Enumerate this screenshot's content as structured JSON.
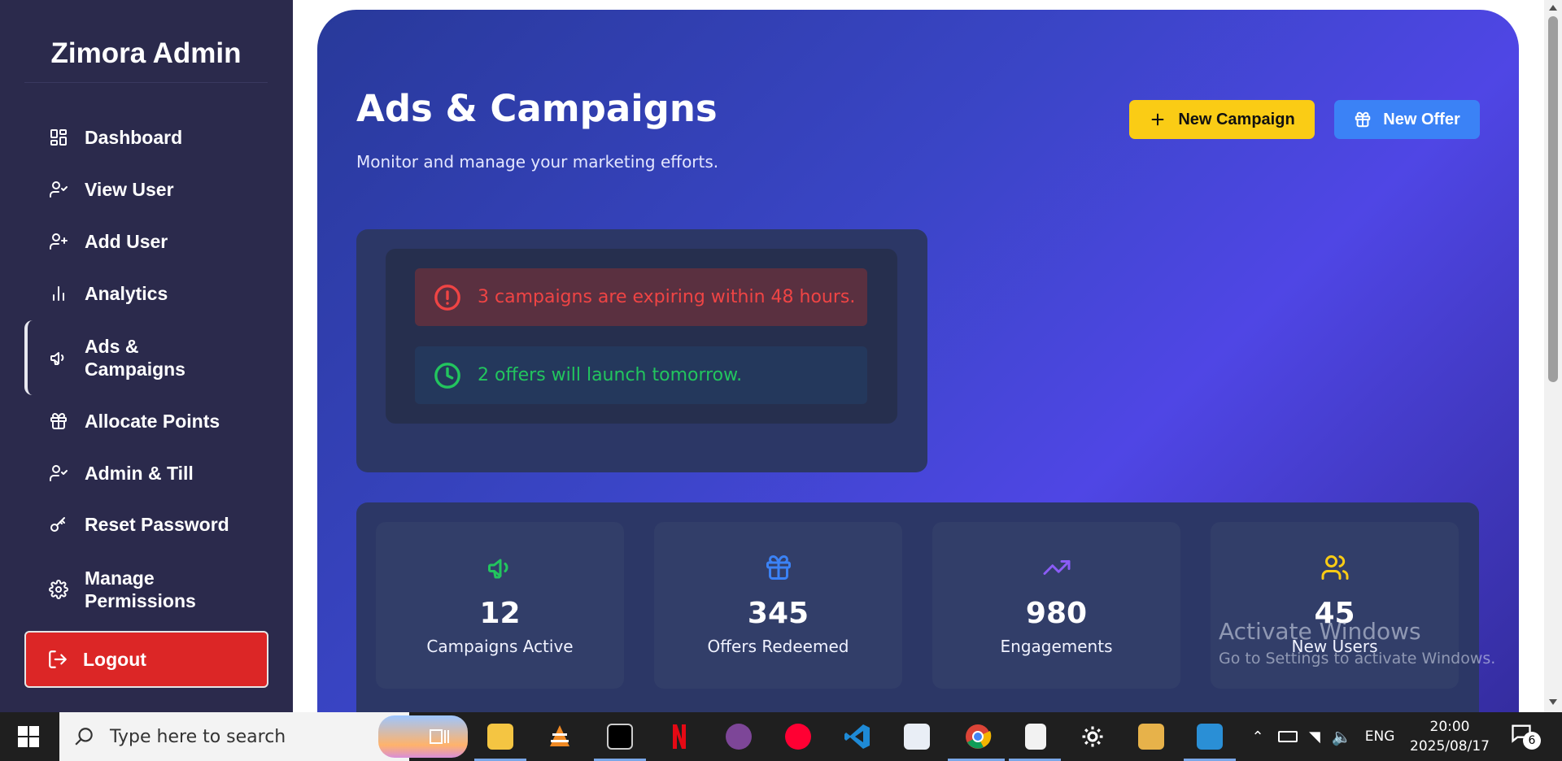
{
  "sidebar": {
    "brand": "Zimora Admin",
    "items": [
      {
        "label": "Dashboard",
        "icon": "dashboard-icon"
      },
      {
        "label": "View User",
        "icon": "user-check-icon"
      },
      {
        "label": "Add User",
        "icon": "user-plus-icon"
      },
      {
        "label": "Analytics",
        "icon": "bar-chart-icon"
      },
      {
        "label_line1": "Ads &",
        "label_line2": "Campaigns",
        "icon": "megaphone-icon",
        "active": true
      },
      {
        "label": "Allocate Points",
        "icon": "gift-icon"
      },
      {
        "label": "Admin & Till",
        "icon": "user-check-icon"
      },
      {
        "label": "Reset Password",
        "icon": "key-icon"
      },
      {
        "label_line1": "Manage",
        "label_line2": "Permissions",
        "icon": "gear-icon"
      }
    ],
    "logout_label": "Logout"
  },
  "main": {
    "title": "Ads & Campaigns",
    "subtitle": "Monitor and manage your marketing efforts.",
    "new_campaign_label": "New Campaign",
    "new_offer_label": "New Offer",
    "alerts": [
      {
        "text": "3 campaigns are expiring within 48 hours.",
        "type": "danger",
        "icon": "alert-circle-icon"
      },
      {
        "text": "2 offers will launch tomorrow.",
        "type": "success",
        "icon": "clock-icon"
      }
    ],
    "stats": [
      {
        "value": "12",
        "label": "Campaigns Active",
        "icon": "megaphone-icon",
        "color": "#22c55e"
      },
      {
        "value": "345",
        "label": "Offers Redeemed",
        "icon": "gift-icon",
        "color": "#3b82f6"
      },
      {
        "value": "980",
        "label": "Engagements",
        "icon": "trending-up-icon",
        "color": "#8b5cf6"
      },
      {
        "value": "45",
        "label": "New Users",
        "icon": "users-icon",
        "color": "#facc15"
      }
    ]
  },
  "watermark": {
    "line1": "Activate Windows",
    "line2": "Go to Settings to activate Windows."
  },
  "taskbar": {
    "search_placeholder": "Type here to search",
    "language": "ENG",
    "time": "20:00",
    "date": "2025/08/17",
    "notification_count": "6"
  },
  "colors": {
    "sidebar_bg": "#2b2a4c",
    "logout_bg": "#dc2626",
    "campaign_button": "#facc15",
    "offer_button": "#3b82f6",
    "danger_text": "#ef4444",
    "success_text": "#22c55e"
  }
}
